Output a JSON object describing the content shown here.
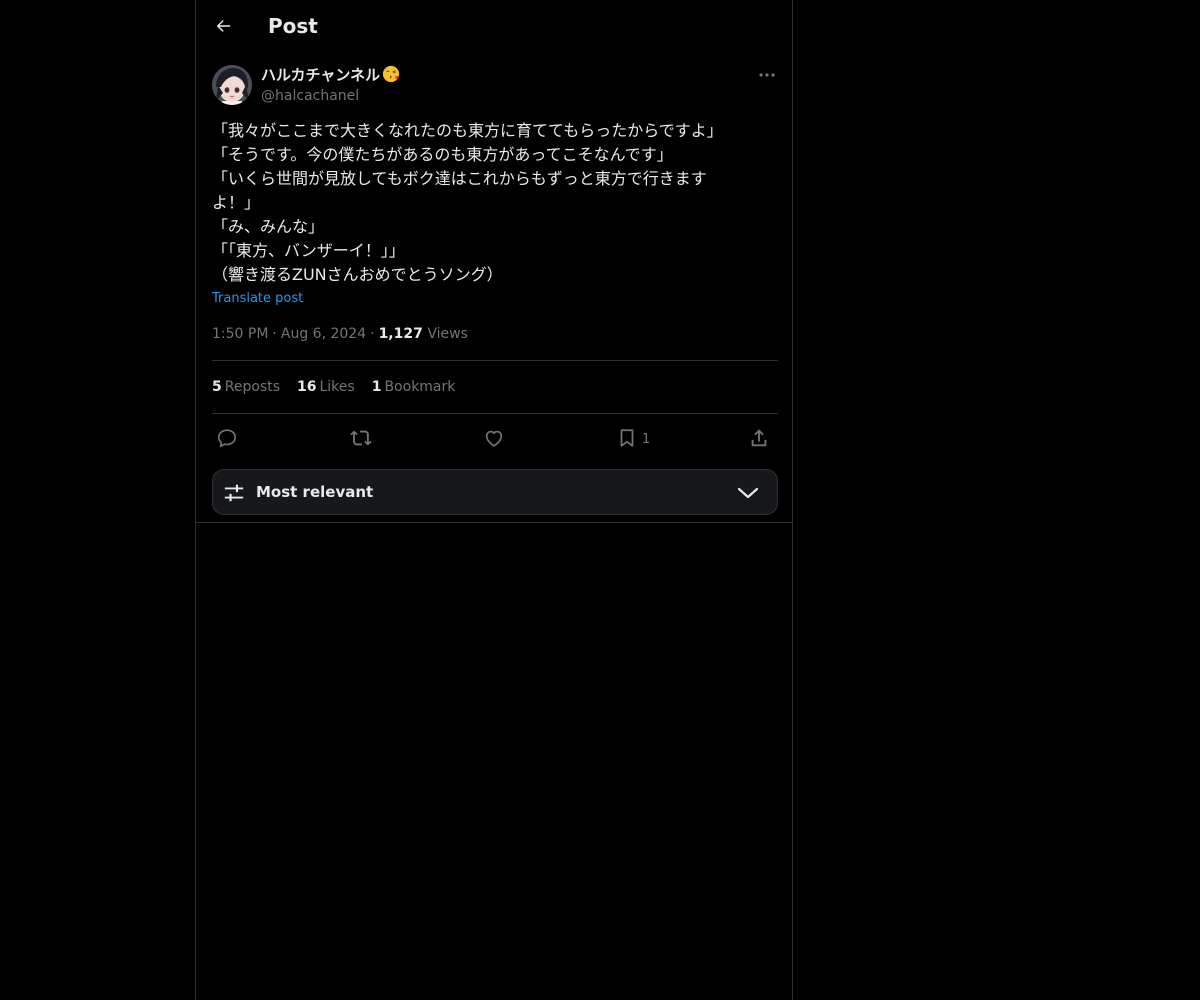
{
  "header": {
    "title": "Post",
    "back_icon": "arrow-left-icon"
  },
  "post": {
    "author": {
      "display_name": "ハルカチャンネル",
      "emoji": "face-blowing-kiss-emoji",
      "handle": "@halcachanel",
      "avatar": "anime-character-avatar"
    },
    "lines": [
      "「我々がここまで大きくなれたのも東方に育ててもらったからですよ」",
      "「そうです。今の僕たちがあるのも東方があってこそなんです」",
      "「いくら世間が見放してもボク達はこれからもずっと東方で行きます",
      "よ！」",
      "「み、みんな」",
      "「「東方、バンザーイ！」」",
      "（響き渡るZUNさんおめでとうソング）"
    ],
    "translate_label": "Translate post",
    "time": "1:50 PM",
    "date": "Aug 6, 2024",
    "views_count": "1,127",
    "views_label": "Views",
    "separator": "·"
  },
  "stats": {
    "reposts_count": "5",
    "reposts_label": "Reposts",
    "likes_count": "16",
    "likes_label": "Likes",
    "bookmarks_count": "1",
    "bookmarks_label": "Bookmark"
  },
  "actions": {
    "reply_icon": "reply-icon",
    "repost_icon": "repost-icon",
    "like_icon": "heart-icon",
    "bookmark_icon": "bookmark-icon",
    "bookmark_count": "1",
    "share_icon": "share-icon"
  },
  "sort": {
    "label": "Most relevant",
    "icon": "sliders-icon",
    "chevron": "chevron-down-icon"
  },
  "colors": {
    "background": "#000000",
    "text": "#e7e9ea",
    "secondary": "#71767b",
    "link": "#1d9bf0",
    "border": "#2f3336",
    "sort_bg": "#16181c"
  }
}
